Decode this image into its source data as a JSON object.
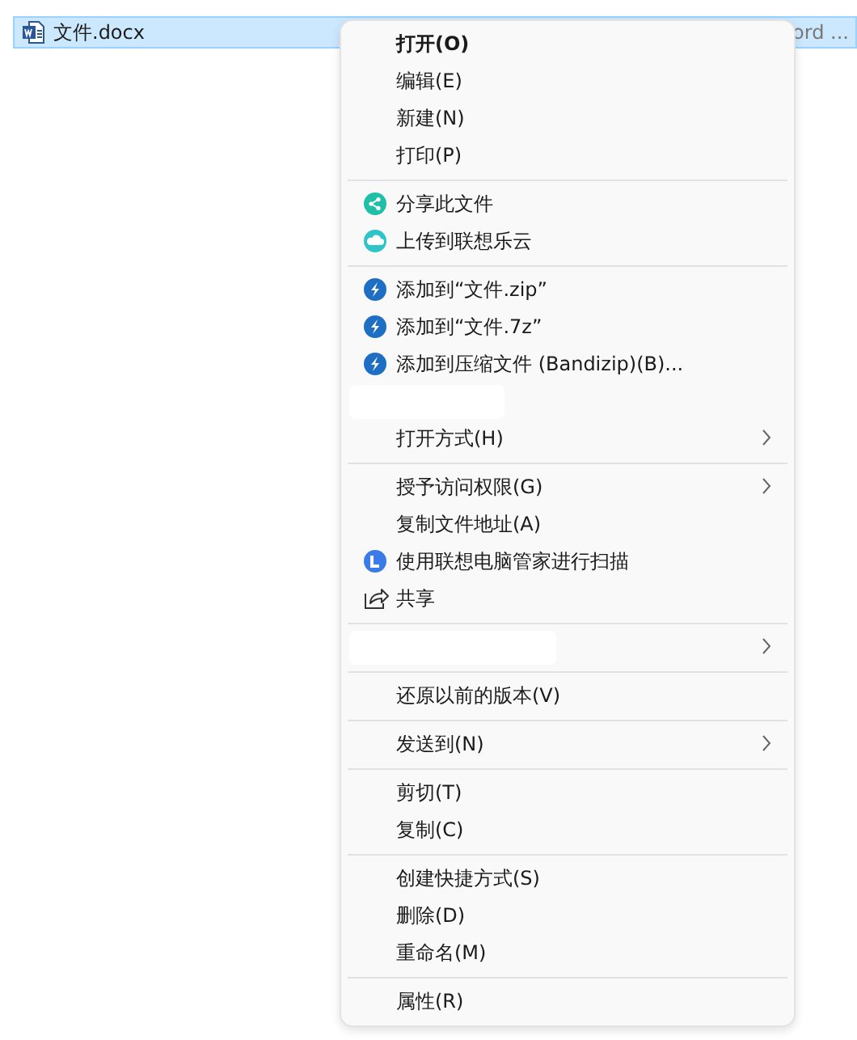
{
  "file_row": {
    "name": "文件.docx",
    "column_2": "ord ...",
    "selected": true
  },
  "context_menu": {
    "sections": [
      [
        {
          "kind": "plain",
          "label": "打开(O)",
          "bold": true
        },
        {
          "kind": "plain",
          "label": "编辑(E)"
        },
        {
          "kind": "plain",
          "label": "新建(N)"
        },
        {
          "kind": "plain",
          "label": "打印(P)"
        }
      ],
      [
        {
          "kind": "share",
          "label": "分享此文件"
        },
        {
          "kind": "cloud",
          "label": "上传到联想乐云"
        }
      ],
      [
        {
          "kind": "bolt",
          "label": "添加到“文件.zip”"
        },
        {
          "kind": "bolt",
          "label": "添加到“文件.7z”"
        },
        {
          "kind": "bolt",
          "label": "添加到压缩文件 (Bandizip)(B)..."
        },
        {
          "kind": "blank"
        },
        {
          "kind": "plain",
          "label": "打开方式(H)",
          "submenu": true
        }
      ],
      [
        {
          "kind": "plain",
          "label": "授予访问权限(G)",
          "submenu": true
        },
        {
          "kind": "plain",
          "label": "复制文件地址(A)"
        },
        {
          "kind": "scan",
          "label": "使用联想电脑管家进行扫描"
        },
        {
          "kind": "share-outline",
          "label": "共享"
        }
      ],
      [
        {
          "kind": "blank",
          "submenu": true
        }
      ],
      [
        {
          "kind": "plain",
          "label": "还原以前的版本(V)"
        }
      ],
      [
        {
          "kind": "plain",
          "label": "发送到(N)",
          "submenu": true
        }
      ],
      [
        {
          "kind": "plain",
          "label": "剪切(T)"
        },
        {
          "kind": "plain",
          "label": "复制(C)"
        }
      ],
      [
        {
          "kind": "plain",
          "label": "创建快捷方式(S)"
        },
        {
          "kind": "plain",
          "label": "删除(D)"
        },
        {
          "kind": "plain",
          "label": "重命名(M)"
        }
      ],
      [
        {
          "kind": "plain",
          "label": "属性(R)"
        }
      ]
    ]
  }
}
